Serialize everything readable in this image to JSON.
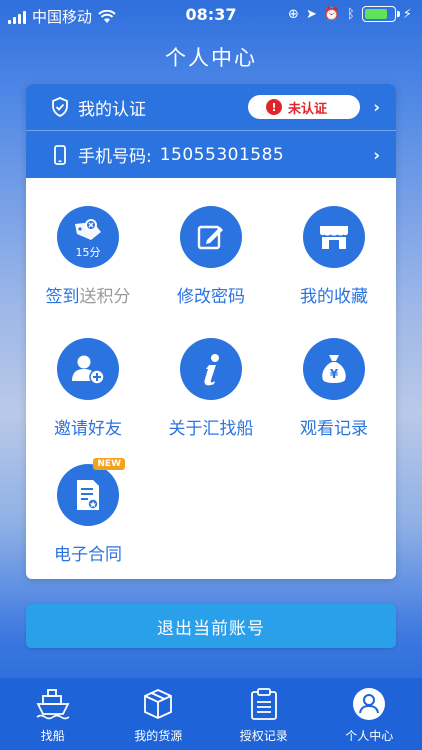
{
  "status_bar": {
    "carrier": "中国移动",
    "time": "08:37"
  },
  "page": {
    "title": "个人中心"
  },
  "account": {
    "verification_label": "我的认证",
    "verification_status": "未认证",
    "phone_label": "手机号码:",
    "phone_number": "15055301585"
  },
  "menu": {
    "sign_in": {
      "label_main": "签到",
      "label_sub": "送积分",
      "icon": "ship-wheel-icon",
      "badge": "15分"
    },
    "change_password": {
      "label": "修改密码",
      "icon": "edit-icon"
    },
    "favorites": {
      "label": "我的收藏",
      "icon": "store-icon"
    },
    "invite": {
      "label": "邀请好友",
      "icon": "add-user-icon"
    },
    "about": {
      "label": "关于汇找船",
      "icon": "info-icon"
    },
    "watch_history": {
      "label": "观看记录",
      "icon": "money-bag-icon",
      "symbol": "¥"
    },
    "contract": {
      "label": "电子合同",
      "icon": "contract-icon",
      "tag": "NEW"
    }
  },
  "logout_label": "退出当前账号",
  "tabs": [
    {
      "label": "找船",
      "icon": "ship-icon"
    },
    {
      "label": "我的货源",
      "icon": "box-icon"
    },
    {
      "label": "授权记录",
      "icon": "clipboard-icon"
    },
    {
      "label": "个人中心",
      "icon": "user-icon"
    }
  ],
  "colors": {
    "primary": "#2b74e0",
    "tabbar": "#1e63d8",
    "logout": "#2a9fea",
    "alert": "#e0262b",
    "new_tag": "#f4a11c"
  }
}
